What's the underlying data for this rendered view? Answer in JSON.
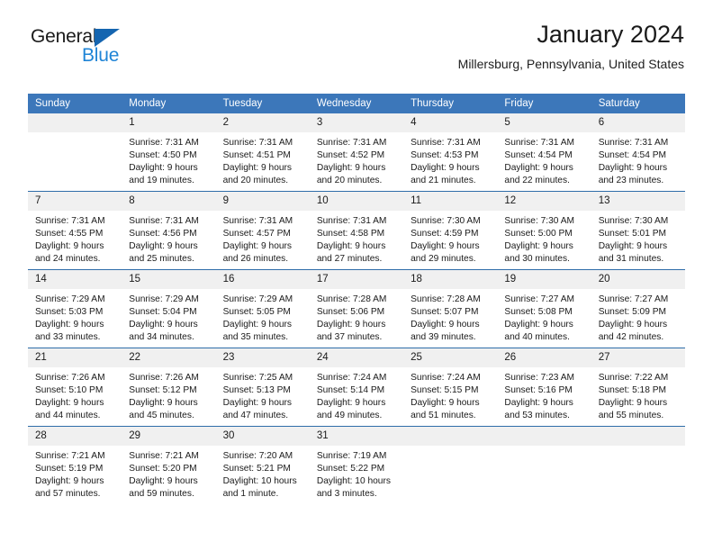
{
  "brand": {
    "name_top": "General",
    "name_bottom": "Blue",
    "triangle_color": "#1565b0",
    "blue_color": "#1f84d6"
  },
  "header": {
    "title": "January 2024",
    "location": "Millersburg, Pennsylvania, United States"
  },
  "theme": {
    "header_blue": "#3c77ba",
    "row_divider": "#2e6da9",
    "daynum_band": "#f0f0f0"
  },
  "weekdays": [
    "Sunday",
    "Monday",
    "Tuesday",
    "Wednesday",
    "Thursday",
    "Friday",
    "Saturday"
  ],
  "weeks": [
    [
      {
        "day": "",
        "sunrise": "",
        "sunset": "",
        "daylight_1": "",
        "daylight_2": ""
      },
      {
        "day": "1",
        "sunrise": "Sunrise: 7:31 AM",
        "sunset": "Sunset: 4:50 PM",
        "daylight_1": "Daylight: 9 hours",
        "daylight_2": "and 19 minutes."
      },
      {
        "day": "2",
        "sunrise": "Sunrise: 7:31 AM",
        "sunset": "Sunset: 4:51 PM",
        "daylight_1": "Daylight: 9 hours",
        "daylight_2": "and 20 minutes."
      },
      {
        "day": "3",
        "sunrise": "Sunrise: 7:31 AM",
        "sunset": "Sunset: 4:52 PM",
        "daylight_1": "Daylight: 9 hours",
        "daylight_2": "and 20 minutes."
      },
      {
        "day": "4",
        "sunrise": "Sunrise: 7:31 AM",
        "sunset": "Sunset: 4:53 PM",
        "daylight_1": "Daylight: 9 hours",
        "daylight_2": "and 21 minutes."
      },
      {
        "day": "5",
        "sunrise": "Sunrise: 7:31 AM",
        "sunset": "Sunset: 4:54 PM",
        "daylight_1": "Daylight: 9 hours",
        "daylight_2": "and 22 minutes."
      },
      {
        "day": "6",
        "sunrise": "Sunrise: 7:31 AM",
        "sunset": "Sunset: 4:54 PM",
        "daylight_1": "Daylight: 9 hours",
        "daylight_2": "and 23 minutes."
      }
    ],
    [
      {
        "day": "7",
        "sunrise": "Sunrise: 7:31 AM",
        "sunset": "Sunset: 4:55 PM",
        "daylight_1": "Daylight: 9 hours",
        "daylight_2": "and 24 minutes."
      },
      {
        "day": "8",
        "sunrise": "Sunrise: 7:31 AM",
        "sunset": "Sunset: 4:56 PM",
        "daylight_1": "Daylight: 9 hours",
        "daylight_2": "and 25 minutes."
      },
      {
        "day": "9",
        "sunrise": "Sunrise: 7:31 AM",
        "sunset": "Sunset: 4:57 PM",
        "daylight_1": "Daylight: 9 hours",
        "daylight_2": "and 26 minutes."
      },
      {
        "day": "10",
        "sunrise": "Sunrise: 7:31 AM",
        "sunset": "Sunset: 4:58 PM",
        "daylight_1": "Daylight: 9 hours",
        "daylight_2": "and 27 minutes."
      },
      {
        "day": "11",
        "sunrise": "Sunrise: 7:30 AM",
        "sunset": "Sunset: 4:59 PM",
        "daylight_1": "Daylight: 9 hours",
        "daylight_2": "and 29 minutes."
      },
      {
        "day": "12",
        "sunrise": "Sunrise: 7:30 AM",
        "sunset": "Sunset: 5:00 PM",
        "daylight_1": "Daylight: 9 hours",
        "daylight_2": "and 30 minutes."
      },
      {
        "day": "13",
        "sunrise": "Sunrise: 7:30 AM",
        "sunset": "Sunset: 5:01 PM",
        "daylight_1": "Daylight: 9 hours",
        "daylight_2": "and 31 minutes."
      }
    ],
    [
      {
        "day": "14",
        "sunrise": "Sunrise: 7:29 AM",
        "sunset": "Sunset: 5:03 PM",
        "daylight_1": "Daylight: 9 hours",
        "daylight_2": "and 33 minutes."
      },
      {
        "day": "15",
        "sunrise": "Sunrise: 7:29 AM",
        "sunset": "Sunset: 5:04 PM",
        "daylight_1": "Daylight: 9 hours",
        "daylight_2": "and 34 minutes."
      },
      {
        "day": "16",
        "sunrise": "Sunrise: 7:29 AM",
        "sunset": "Sunset: 5:05 PM",
        "daylight_1": "Daylight: 9 hours",
        "daylight_2": "and 35 minutes."
      },
      {
        "day": "17",
        "sunrise": "Sunrise: 7:28 AM",
        "sunset": "Sunset: 5:06 PM",
        "daylight_1": "Daylight: 9 hours",
        "daylight_2": "and 37 minutes."
      },
      {
        "day": "18",
        "sunrise": "Sunrise: 7:28 AM",
        "sunset": "Sunset: 5:07 PM",
        "daylight_1": "Daylight: 9 hours",
        "daylight_2": "and 39 minutes."
      },
      {
        "day": "19",
        "sunrise": "Sunrise: 7:27 AM",
        "sunset": "Sunset: 5:08 PM",
        "daylight_1": "Daylight: 9 hours",
        "daylight_2": "and 40 minutes."
      },
      {
        "day": "20",
        "sunrise": "Sunrise: 7:27 AM",
        "sunset": "Sunset: 5:09 PM",
        "daylight_1": "Daylight: 9 hours",
        "daylight_2": "and 42 minutes."
      }
    ],
    [
      {
        "day": "21",
        "sunrise": "Sunrise: 7:26 AM",
        "sunset": "Sunset: 5:10 PM",
        "daylight_1": "Daylight: 9 hours",
        "daylight_2": "and 44 minutes."
      },
      {
        "day": "22",
        "sunrise": "Sunrise: 7:26 AM",
        "sunset": "Sunset: 5:12 PM",
        "daylight_1": "Daylight: 9 hours",
        "daylight_2": "and 45 minutes."
      },
      {
        "day": "23",
        "sunrise": "Sunrise: 7:25 AM",
        "sunset": "Sunset: 5:13 PM",
        "daylight_1": "Daylight: 9 hours",
        "daylight_2": "and 47 minutes."
      },
      {
        "day": "24",
        "sunrise": "Sunrise: 7:24 AM",
        "sunset": "Sunset: 5:14 PM",
        "daylight_1": "Daylight: 9 hours",
        "daylight_2": "and 49 minutes."
      },
      {
        "day": "25",
        "sunrise": "Sunrise: 7:24 AM",
        "sunset": "Sunset: 5:15 PM",
        "daylight_1": "Daylight: 9 hours",
        "daylight_2": "and 51 minutes."
      },
      {
        "day": "26",
        "sunrise": "Sunrise: 7:23 AM",
        "sunset": "Sunset: 5:16 PM",
        "daylight_1": "Daylight: 9 hours",
        "daylight_2": "and 53 minutes."
      },
      {
        "day": "27",
        "sunrise": "Sunrise: 7:22 AM",
        "sunset": "Sunset: 5:18 PM",
        "daylight_1": "Daylight: 9 hours",
        "daylight_2": "and 55 minutes."
      }
    ],
    [
      {
        "day": "28",
        "sunrise": "Sunrise: 7:21 AM",
        "sunset": "Sunset: 5:19 PM",
        "daylight_1": "Daylight: 9 hours",
        "daylight_2": "and 57 minutes."
      },
      {
        "day": "29",
        "sunrise": "Sunrise: 7:21 AM",
        "sunset": "Sunset: 5:20 PM",
        "daylight_1": "Daylight: 9 hours",
        "daylight_2": "and 59 minutes."
      },
      {
        "day": "30",
        "sunrise": "Sunrise: 7:20 AM",
        "sunset": "Sunset: 5:21 PM",
        "daylight_1": "Daylight: 10 hours",
        "daylight_2": "and 1 minute."
      },
      {
        "day": "31",
        "sunrise": "Sunrise: 7:19 AM",
        "sunset": "Sunset: 5:22 PM",
        "daylight_1": "Daylight: 10 hours",
        "daylight_2": "and 3 minutes."
      },
      {
        "day": "",
        "sunrise": "",
        "sunset": "",
        "daylight_1": "",
        "daylight_2": ""
      },
      {
        "day": "",
        "sunrise": "",
        "sunset": "",
        "daylight_1": "",
        "daylight_2": ""
      },
      {
        "day": "",
        "sunrise": "",
        "sunset": "",
        "daylight_1": "",
        "daylight_2": ""
      }
    ]
  ]
}
